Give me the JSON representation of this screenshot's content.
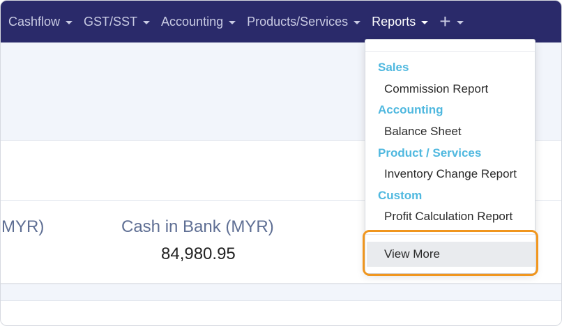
{
  "navbar": {
    "items": [
      {
        "label": "Cashflow"
      },
      {
        "label": "GST/SST"
      },
      {
        "label": "Accounting"
      },
      {
        "label": "Products/Services"
      },
      {
        "label": "Reports"
      },
      {
        "label": "+"
      }
    ]
  },
  "stats": {
    "left_partial_label": "MYR)",
    "cash_in_bank_label": "Cash in Bank (MYR)",
    "cash_in_bank_value": "84,980.95"
  },
  "reports_menu": {
    "sections": [
      {
        "heading": "Sales",
        "item": "Commission Report"
      },
      {
        "heading": "Accounting",
        "item": "Balance Sheet"
      },
      {
        "heading": "Product / Services",
        "item": "Inventory Change Report"
      },
      {
        "heading": "Custom",
        "item": "Profit Calculation Report"
      }
    ],
    "view_more": "View More"
  },
  "colors": {
    "navbar": "#2a2a6a",
    "section_heading": "#4fb8df",
    "highlight": "#f0961e"
  }
}
